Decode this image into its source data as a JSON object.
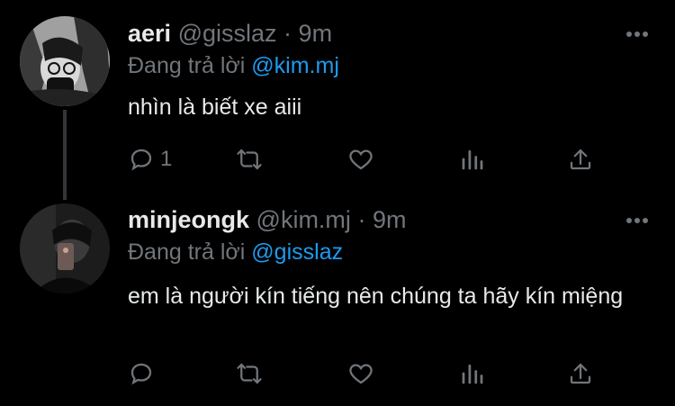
{
  "tweets": [
    {
      "name": "aeri",
      "handle": "@gisslaz",
      "sep": "·",
      "time": "9m",
      "reply_prefix": "Đang trả lời",
      "reply_to": "@kim.mj",
      "text": "nhìn là biết xe aiii",
      "reply_count": "1"
    },
    {
      "name": "minjeongk",
      "handle": "@kim.mj",
      "sep": "·",
      "time": "9m",
      "reply_prefix": "Đang trả lời",
      "reply_to": "@gisslaz",
      "text": "em là người kín tiếng nên chúng ta hãy kín miệng",
      "reply_count": ""
    }
  ],
  "icons": {
    "reply": "reply-icon",
    "retweet": "retweet-icon",
    "like": "heart-icon",
    "views": "views-icon",
    "share": "share-icon",
    "more": "more-icon"
  },
  "colors": {
    "background": "#000000",
    "text": "#e7e9ea",
    "muted": "#71767b",
    "accent": "#1d9bf0"
  }
}
